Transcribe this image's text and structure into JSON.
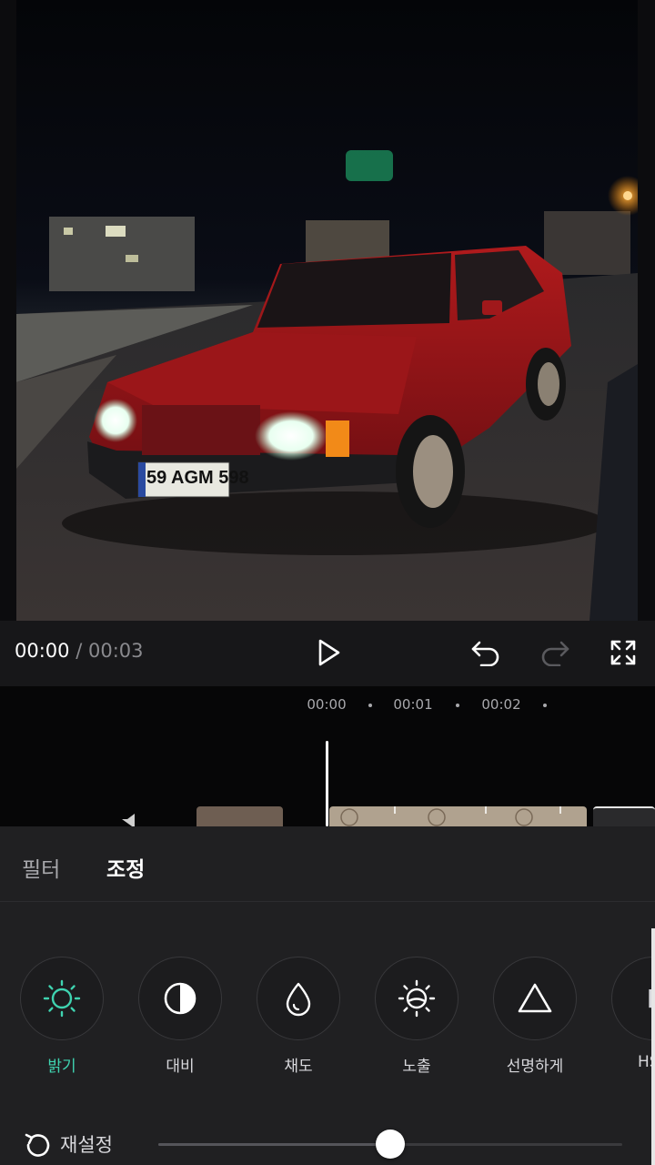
{
  "playback": {
    "current_time": "00:00",
    "separator": "/",
    "duration": "00:03"
  },
  "timeline": {
    "ruler_ticks": [
      "00:00",
      "00:01",
      "00:02"
    ]
  },
  "photo": {
    "license_plate": "59 AGM 598"
  },
  "tabs": {
    "filter": "필터",
    "adjust": "조정"
  },
  "tools": {
    "brightness": "밝기",
    "contrast": "대비",
    "saturation": "채도",
    "exposure": "노출",
    "sharpen": "선명하게",
    "hsl": "HS",
    "hsl_icon_text": "HS"
  },
  "reset": {
    "label": "재설정"
  },
  "slider": {
    "value_fraction": 0.5
  },
  "colors": {
    "accent": "#3fd3b0",
    "panel_bg": "#202022",
    "timeline_bg": "#060607"
  }
}
